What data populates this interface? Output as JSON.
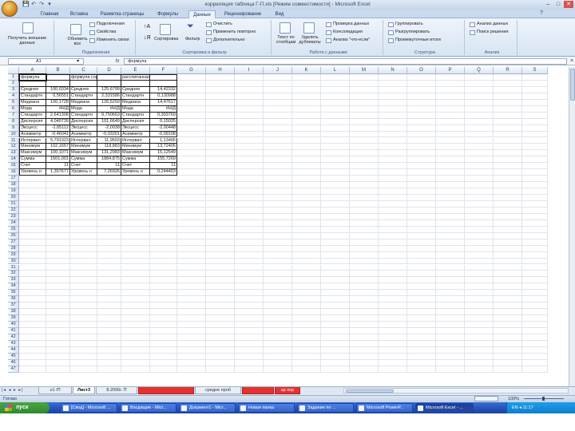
{
  "window": {
    "title": "корреляция таблица Г-П.xls  [Режим совместимости] - Microsoft Excel",
    "controls": [
      "–",
      "□",
      "✕"
    ]
  },
  "qat": [
    "💾",
    "↶",
    "↷",
    "▾"
  ],
  "ribbon_tabs": [
    "Главная",
    "Вставка",
    "Разметка страницы",
    "Формулы",
    "Данные",
    "Рецензирование",
    "Вид"
  ],
  "active_tab_index": 4,
  "ribbon_groups": [
    {
      "label": "Получить внешние данные",
      "items": [
        "Получить внешние данные"
      ]
    },
    {
      "label": "Подключения",
      "items": [
        "Подключения",
        "Свойства",
        "Изменить связи",
        "Обновить все"
      ]
    },
    {
      "label": "Сортировка и фильтр",
      "items": [
        "Сортировка",
        "Фильтр",
        "Очистить",
        "Применить повторно",
        "Дополнительно"
      ]
    },
    {
      "label": "Работа с данными",
      "items": [
        "Текст по столбцам",
        "Удалить дубликаты",
        "Проверка данных",
        "Консолидация",
        "Анализ \"что-если\""
      ]
    },
    {
      "label": "Структура",
      "items": [
        "Группировать",
        "Разгруппировать",
        "Промежуточные итоги"
      ]
    },
    {
      "label": "Анализ",
      "items": [
        "Анализ данных",
        "Поиск решения"
      ]
    }
  ],
  "formula_bar": {
    "name_box": "A1",
    "fx": "fx",
    "formula": "формула"
  },
  "columns": [
    "A",
    "B",
    "C",
    "D",
    "E",
    "F",
    "G",
    "H",
    "I",
    "J",
    "K",
    "L",
    "M",
    "N",
    "O",
    "P",
    "Q",
    "R",
    "S"
  ],
  "rows": [
    [
      "формула",
      "",
      "формула сорт",
      "",
      "рассчитанная",
      ""
    ],
    [
      "",
      "",
      "",
      "",
      "",
      ""
    ],
    [
      "Среднее",
      "100,0334",
      "Среднее",
      "125,6799",
      "Среднее",
      "14,42332"
    ],
    [
      "Стандартн",
      "0,56551",
      "Стандартн",
      "2,331586",
      "Стандартн",
      "0,130988"
    ],
    [
      "Медиана",
      "100,1728",
      "Медиана",
      "126,5259",
      "Медиана",
      "14,47617"
    ],
    [
      "Мода",
      "#Н/Д",
      "Мода",
      "#Н/Д",
      "Мода",
      "#Н/Д"
    ],
    [
      "Стандартн",
      "2,641308",
      "Стандартн",
      "9,750663",
      "Стандартн",
      "0,393769"
    ],
    [
      "Дисперсия",
      "4,040739",
      "Дисперсия",
      "101,6649",
      "Дисперсия",
      "0,15025"
    ],
    [
      "Эксцесс",
      "-1,65112",
      "Эксцесс",
      "-2,0038",
      "Эксцесс",
      "-2,00448"
    ],
    [
      "Асимметр",
      "-0,46041",
      "Асимметр",
      "-0,03201",
      "Асимметр",
      "-0,09108"
    ],
    [
      "Интервал",
      "5,791323",
      "Интервал",
      "11,9503",
      "Интервал",
      "1,13406"
    ],
    [
      "Минимум",
      "102,1657",
      "Минимум",
      "118,883",
      "Минимум",
      "13,72406"
    ],
    [
      "Максимум",
      "100,1071",
      "Максимум",
      "131,2083",
      "Максимум",
      "15,12549"
    ],
    [
      "Сумма",
      "1501,001",
      "Сумма",
      "1884,875",
      "Сумма",
      "155,7269"
    ],
    [
      "Счет",
      "11",
      "Счет",
      "11",
      "Счет",
      "11"
    ],
    [
      "Уровень н",
      "1,357677",
      "Уровень н",
      "7,26926",
      "Уровень н",
      "0,244403"
    ]
  ],
  "row_count": 47,
  "sheet_tabs": [
    {
      "label": "н1 /П",
      "style": "normal"
    },
    {
      "label": "Лист3",
      "style": "active"
    },
    {
      "label": "8.2006г. П",
      "style": "normal"
    },
    {
      "label": "",
      "style": "red"
    },
    {
      "label": "средне проб",
      "style": "normal"
    },
    {
      "label": "",
      "style": "red"
    },
    {
      "label": "ар пор",
      "style": "red"
    }
  ],
  "sheet_nav": [
    "|◂",
    "◂",
    "▸",
    "▸|"
  ],
  "status": {
    "left": "Готово",
    "zoom": "100%"
  },
  "taskbar": {
    "start": "пуск",
    "tasks": [
      {
        "label": "[Свод] - Microsoft ...",
        "active": false
      },
      {
        "label": "Входящие - Micr...",
        "active": false
      },
      {
        "label": "Документ1 - Micr...",
        "active": false
      },
      {
        "label": "Новая папка",
        "active": false
      },
      {
        "label": "Задание по ...",
        "active": false
      },
      {
        "label": "Microsoft PowerP...",
        "active": false
      },
      {
        "label": "Microsoft Excel - ...",
        "active": true
      }
    ],
    "tray": "EN  ◂ 11:17"
  },
  "accent": {
    "ribbon": "#c9d9ee",
    "taskbar": "#2350b5",
    "start": "#2f8a2e",
    "tab_red": "#e4322e"
  }
}
